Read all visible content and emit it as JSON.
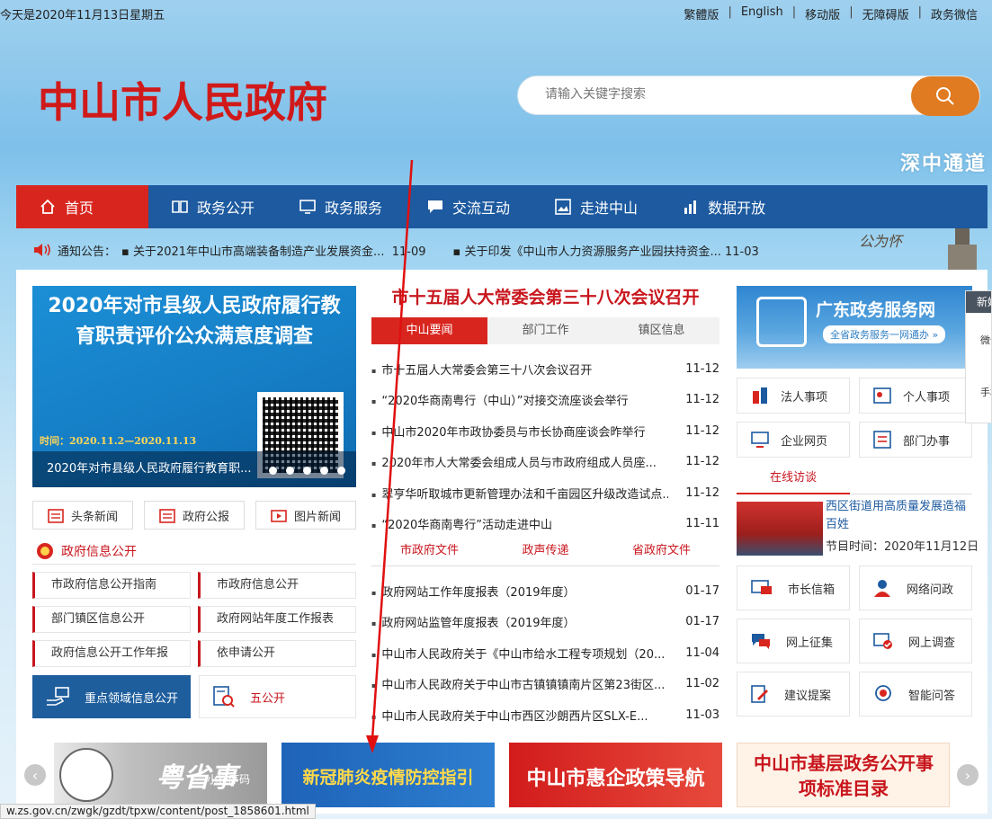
{
  "top": {
    "date": "今天是2020年11月13日星期五",
    "links": [
      "繁體版",
      "English",
      "移动版",
      "无障碍版",
      "政务微信"
    ]
  },
  "header": {
    "logo_text": "中山市人民政府",
    "search_placeholder": "请输入关键字搜索",
    "bridge_caption": "深中通道"
  },
  "nav": {
    "items": [
      {
        "label": "首页",
        "icon": "home-icon"
      },
      {
        "label": "政务公开",
        "icon": "book-icon"
      },
      {
        "label": "政务服务",
        "icon": "monitor-icon"
      },
      {
        "label": "交流互动",
        "icon": "chat-icon"
      },
      {
        "label": "走进中山",
        "icon": "picture-icon"
      },
      {
        "label": "数据开放",
        "icon": "chart-icon"
      }
    ]
  },
  "notice": {
    "label": "通知公告：",
    "items": [
      {
        "text": "关于2021年中山市高端装备制造产业发展资金...",
        "date": "11-09"
      },
      {
        "text": "关于印发《中山市人力资源服务产业园扶持资金...",
        "date": "11-03"
      }
    ],
    "slogan": "公为怀"
  },
  "feature": {
    "title": "2020年对市县级人民政府履行教育职责评价公众满意度调查",
    "time": "时间：2020.11.2—2020.11.13",
    "caption": "2020年对市县级人民政府履行教育职..."
  },
  "mini_buttons": [
    "头条新闻",
    "政府公报",
    "图片新闻"
  ],
  "info_public": {
    "title": "政府信息公开",
    "items": [
      "市政府信息公开指南",
      "市政府信息公开",
      "部门镇区信息公开",
      "政府网站年度工作报表",
      "政府信息公开工作年报",
      "依申请公开"
    ],
    "big_btn_1": "重点领域信息公开",
    "big_btn_2": "五公开"
  },
  "news": {
    "headline": "市十五届人大常委会第三十八次会议召开",
    "tabs": [
      "中山要闻",
      "部门工作",
      "镇区信息"
    ],
    "items": [
      {
        "text": "市十五届人大常委会第三十八次会议召开",
        "date": "11-12"
      },
      {
        "text": "“2020华商南粤行（中山）”对接交流座谈会举行",
        "date": "11-12"
      },
      {
        "text": "中山市2020年市政协委员与市长协商座谈会昨举行",
        "date": "11-12"
      },
      {
        "text": "2020年市人大常委会组成人员与市政府组成人员座...",
        "date": "11-12"
      },
      {
        "text": "翠亨华听取城市更新管理办法和千亩园区升级改造试点...",
        "date": "11-12"
      },
      {
        "text": "“2020华商南粤行”活动走进中山",
        "date": "11-11"
      }
    ],
    "tabs2": [
      "市政府文件",
      "政声传递",
      "省政府文件"
    ],
    "files": [
      {
        "text": "政府网站工作年度报表（2019年度）",
        "date": "01-17"
      },
      {
        "text": "政府网站监管年度报表（2019年度）",
        "date": "01-17"
      },
      {
        "text": "中山市人民政府关于《中山市给水工程专项规划（20...",
        "date": "11-04"
      },
      {
        "text": "中山市人民政府关于中山市古镇镇镇南片区第23街区...",
        "date": "11-02"
      },
      {
        "text": "中山市人民政府关于中山市西区沙朗西片区SLX-E...",
        "date": "11-03"
      }
    ]
  },
  "right": {
    "gd_title": "广东政务服务网",
    "gd_sub": "全省政务服务一网通办 »",
    "cards": [
      "法人事项",
      "个人事项",
      "企业网页",
      "部门办事"
    ],
    "interview_tab": "在线访谈",
    "interview_title": "西区街道用高质量发展造福百姓",
    "interview_time": "节目时间：2020年11月12日",
    "cards2": [
      "市长信箱",
      "网络问政",
      "网上征集",
      "网上调查",
      "建议提案",
      "智能问答"
    ]
  },
  "side_widget": {
    "header": "新媒体",
    "items": [
      "微信",
      "手机"
    ]
  },
  "banners": [
    {
      "text": "粤省事",
      "sub": "小程序码"
    },
    {
      "text": "新冠肺炎疫情防控指引"
    },
    {
      "text": "中山市惠企政策导航"
    },
    {
      "text": "中山市基层政务公开事项标准目录"
    }
  ],
  "status_url": "w.zs.gov.cn/zwgk/gzdt/tpxw/content/post_1858601.html",
  "colors": {
    "nav_blue": "#1d5aa0",
    "accent_red": "#d8261f",
    "search_orange": "#e07b22"
  }
}
